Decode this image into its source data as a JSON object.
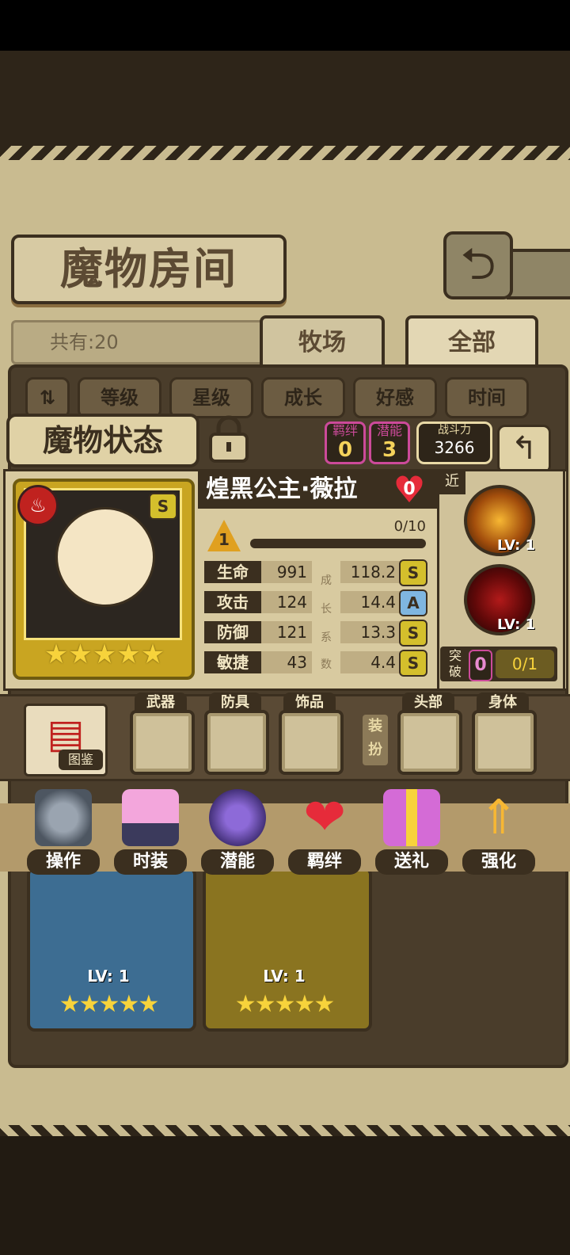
{
  "header": {
    "title": "魔物房间",
    "back_icon": "return-arrow-icon"
  },
  "filter": {
    "count_label": "共有:20",
    "tabs": [
      "牧场",
      "全部"
    ],
    "active_tab": "全部"
  },
  "sort": {
    "toggle_icon": "sort-toggle-icon",
    "buttons": [
      "等级",
      "星级",
      "成长",
      "好感",
      "时间"
    ]
  },
  "status_panel": {
    "title": "魔物状态",
    "bond": {
      "label": "羁绊",
      "value": "0"
    },
    "potential": {
      "label": "潜能",
      "value": "3"
    },
    "power": {
      "label": "战斗力",
      "value": "3266"
    }
  },
  "monster": {
    "name": "煌黑公主·薇拉",
    "affection": "0",
    "rank": "S",
    "stars": "★★★★★",
    "level": "1",
    "exp": "0/10",
    "exp_fraction": 0,
    "growth_label_chars": [
      "成",
      "长",
      "系",
      "数"
    ],
    "attributes": [
      {
        "name": "生命",
        "value": "991",
        "growth": "118.2",
        "grade": "S"
      },
      {
        "name": "攻击",
        "value": "124",
        "growth": "14.4",
        "grade": "A"
      },
      {
        "name": "防御",
        "value": "121",
        "growth": "13.3",
        "grade": "S"
      },
      {
        "name": "敏捷",
        "value": "43",
        "growth": "4.4",
        "grade": "S"
      }
    ]
  },
  "skills": {
    "range_tag": "近",
    "items": [
      {
        "level": "LV: 1"
      },
      {
        "level": "LV: 1"
      }
    ],
    "breakthrough": {
      "label": "突破",
      "count": "0",
      "progress": "0/1"
    }
  },
  "equipment": {
    "book_label": "图鉴",
    "slots": [
      "武器",
      "防具",
      "饰品"
    ],
    "dress_label": "装扮",
    "dress_slots": [
      "头部",
      "身体"
    ]
  },
  "actions": [
    {
      "label": "操作",
      "icon": "gear-icon"
    },
    {
      "label": "时装",
      "icon": "dress-icon"
    },
    {
      "label": "潜能",
      "icon": "demon-icon"
    },
    {
      "label": "羁绊",
      "icon": "hearts-icon"
    },
    {
      "label": "送礼",
      "icon": "gift-icon"
    },
    {
      "label": "强化",
      "icon": "upgrade-arrows-icon"
    }
  ],
  "cards": [
    {
      "level": "LV: 1",
      "stars": "★★★★★"
    },
    {
      "level": "LV: 1",
      "stars": "★★★★★"
    }
  ],
  "colors": {
    "accent": "#cc4a9a",
    "gold": "#f7d33b",
    "frame": "#3b2f1f"
  }
}
